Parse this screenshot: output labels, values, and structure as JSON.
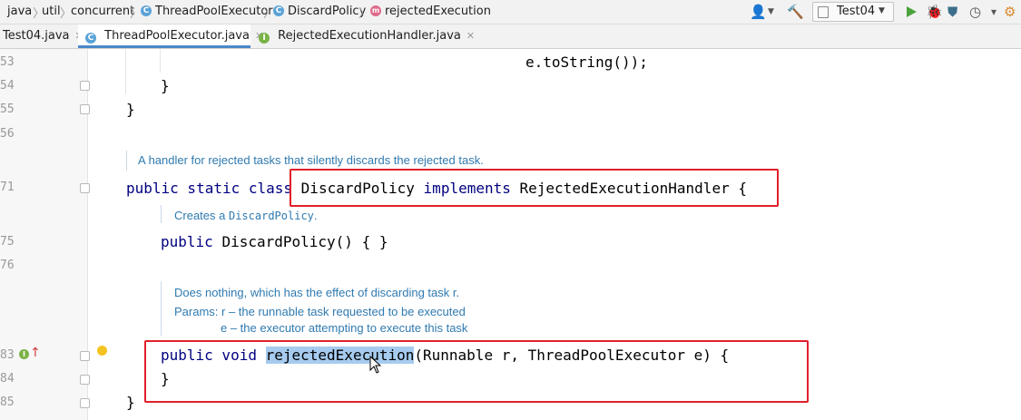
{
  "breadcrumb": {
    "items": [
      "java",
      "util",
      "concurrent",
      "ThreadPoolExecutor",
      "DiscardPolicy",
      "rejectedExecution"
    ]
  },
  "toolbar": {
    "run_config": "Test04",
    "dropdown_glyph": "▼"
  },
  "tabs": [
    {
      "label": "Test04.java"
    },
    {
      "label": "ThreadPoolExecutor.java"
    },
    {
      "label": "RejectedExecutionHandler.java"
    }
  ],
  "editor": {
    "line_numbers": [
      "53",
      "54",
      "55",
      "56",
      "71",
      "75",
      "76",
      "83",
      "84",
      "85"
    ],
    "code": {
      "to_string_call": "e.toString());",
      "brace_inner": "}",
      "brace_outer": "}",
      "class_kw": "public static class",
      "class_name": "DiscardPolicy",
      "implements_kw": "implements",
      "iface_name": "RejectedExecutionHandler {",
      "ctor_kw": "public",
      "ctor_rest": "DiscardPolicy() { }",
      "method_kw": "public void",
      "method_name": "rejectedExecution",
      "method_params": "(Runnable r, ThreadPoolExecutor e) {",
      "method_close": "}",
      "class_close": "}"
    },
    "docs": {
      "class_doc": "A handler for rejected tasks that silently discards the rejected task.",
      "ctor_doc_prefix": "Creates a ",
      "ctor_doc_code": "DiscardPolicy",
      "ctor_doc_suffix": ".",
      "method_doc": "Does nothing, which has the effect of discarding task r.",
      "params_line1": "Params: r – the runnable task requested to be executed",
      "params_line2": "e – the executor attempting to execute this task"
    }
  },
  "colors": {
    "keyword": "#000080",
    "doc": "#2f7ab0",
    "highlight_box": "#e0202a",
    "selection": "#a6cbef",
    "active_tab_underline": "#4a88c7"
  }
}
